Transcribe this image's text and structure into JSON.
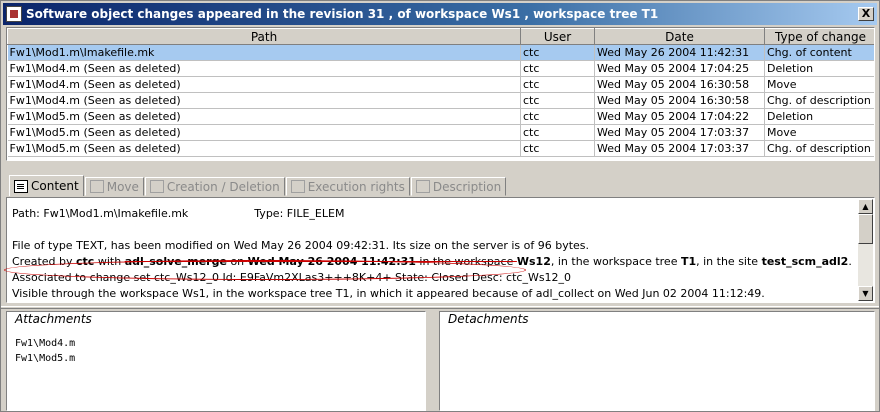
{
  "window": {
    "title": "Software object changes appeared in the revision 31 , of workspace Ws1 , workspace tree T1",
    "close_label": "X"
  },
  "table": {
    "columns": [
      "Path",
      "User",
      "Date",
      "Type of change"
    ],
    "rows": [
      [
        "Fw1\\Mod1.m\\Imakefile.mk",
        "ctc",
        "Wed May 26 2004 11:42:31",
        "Chg. of content"
      ],
      [
        "Fw1\\Mod4.m (Seen as deleted)",
        "ctc",
        "Wed May 05 2004 17:04:25",
        "Deletion"
      ],
      [
        "Fw1\\Mod4.m (Seen as deleted)",
        "ctc",
        "Wed May 05 2004 16:30:58",
        "Move"
      ],
      [
        "Fw1\\Mod4.m (Seen as deleted)",
        "ctc",
        "Wed May 05 2004 16:30:58",
        "Chg. of description"
      ],
      [
        "Fw1\\Mod5.m (Seen as deleted)",
        "ctc",
        "Wed May 05 2004 17:04:22",
        "Deletion"
      ],
      [
        "Fw1\\Mod5.m (Seen as deleted)",
        "ctc",
        "Wed May 05 2004 17:03:37",
        "Move"
      ],
      [
        "Fw1\\Mod5.m (Seen as deleted)",
        "ctc",
        "Wed May 05 2004 17:03:37",
        "Chg. of description"
      ]
    ]
  },
  "tabs": [
    {
      "label": "Content",
      "active": true
    },
    {
      "label": "Move",
      "active": false
    },
    {
      "label": "Creation / Deletion",
      "active": false
    },
    {
      "label": "Execution rights",
      "active": false
    },
    {
      "label": "Description",
      "active": false
    }
  ],
  "details": {
    "path_label": "Path: Fw1\\Mod1.m\\Imakefile.mk",
    "type_label": "Type: FILE_ELEM",
    "line_modified": "File of type TEXT, has been modified on Wed May 26 2004 09:42:31. Its size on the server is of 96 bytes.",
    "created_prefix": "Created by ",
    "created_user": "ctc",
    "created_with": " with ",
    "created_cmd": "adl_solve_merge",
    "created_on": " on ",
    "created_date": "Wed May 26 2004 11:42:31",
    "created_ws_prefix": " in the workspace ",
    "created_ws": "Ws12",
    "created_tree_prefix": ", in the workspace tree ",
    "created_tree": "T1",
    "created_site_prefix": ", in the site ",
    "created_site": "test_scm_adl2",
    "created_end": ".",
    "associated": "Associated to change set ctc_Ws12_0   Id: E9FaVm2XLas3+++8K+4+   State: Closed   Desc: ctc_Ws12_0",
    "visible": "Visible through the workspace Ws1, in the workspace tree T1, in which it appeared because of adl_collect on Wed Jun 02 2004 11:12:49."
  },
  "attachments": {
    "legend": "Attachments",
    "items": [
      "Fw1\\Mod4.m",
      "Fw1\\Mod5.m"
    ]
  },
  "detachments": {
    "legend": "Detachments",
    "items": []
  },
  "colors": {
    "selection": "#a6caf0",
    "title_bar": "#0a246a",
    "annotation": "#cc0000"
  }
}
